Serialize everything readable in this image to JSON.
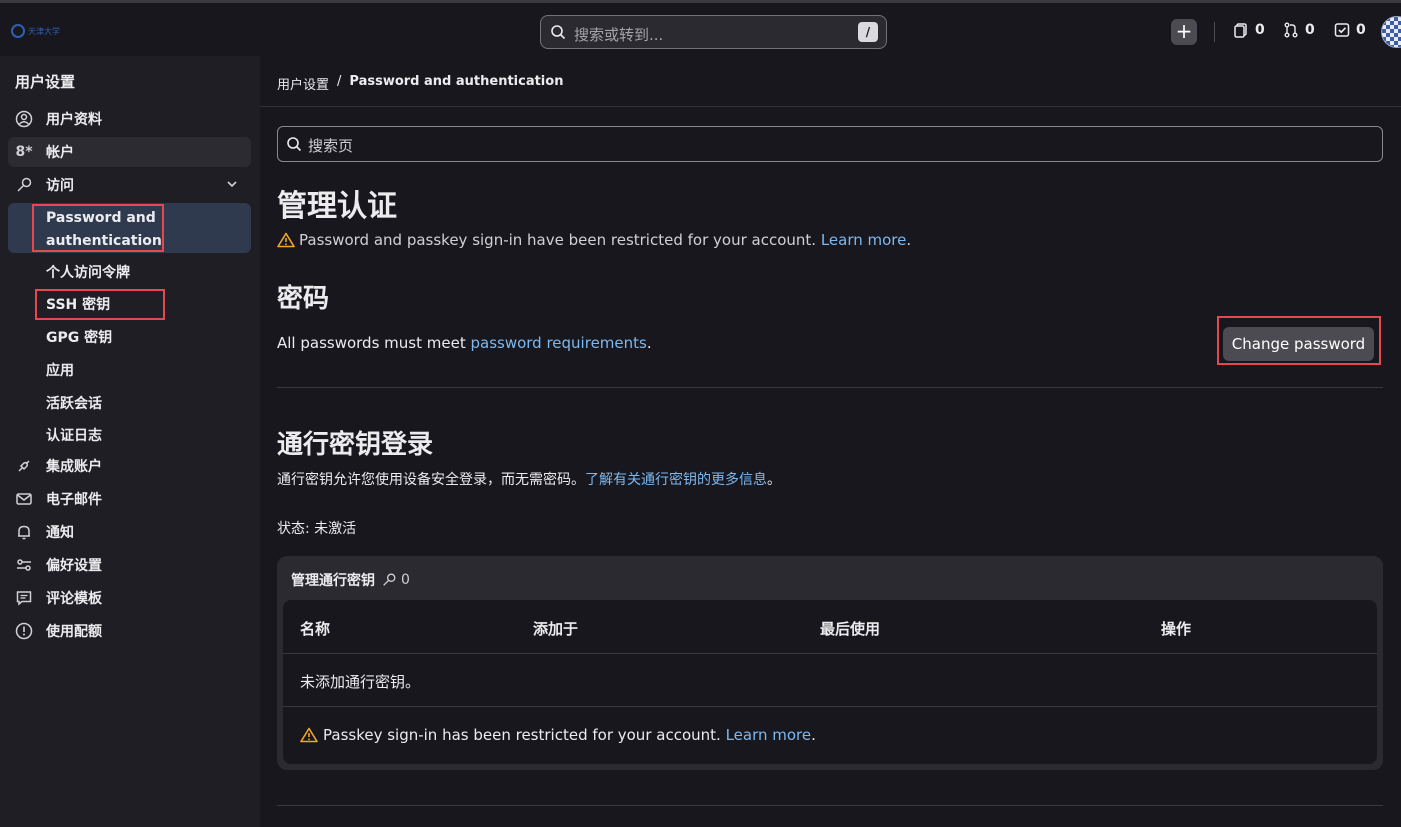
{
  "header": {
    "logo_text": "天津大学",
    "search_placeholder": "搜索或转到...",
    "search_shortcut": "/",
    "counters": [
      {
        "name": "issues",
        "value": "0"
      },
      {
        "name": "merge-requests",
        "value": "0"
      },
      {
        "name": "todos",
        "value": "0"
      }
    ]
  },
  "sidebar": {
    "title": "用户设置",
    "items": [
      {
        "label": "用户资料"
      },
      {
        "label": "帐户"
      },
      {
        "label": "访问"
      }
    ],
    "access_sub": [
      {
        "label_line1": "Password and",
        "label_line2": "authentication"
      },
      {
        "label": "个人访问令牌"
      },
      {
        "label": "SSH 密钥"
      },
      {
        "label": "GPG 密钥"
      },
      {
        "label": "应用"
      },
      {
        "label": "活跃会话"
      },
      {
        "label": "认证日志"
      }
    ],
    "items2": [
      {
        "label": "集成账户"
      },
      {
        "label": "电子邮件"
      },
      {
        "label": "通知"
      },
      {
        "label": "偏好设置"
      },
      {
        "label": "评论模板"
      },
      {
        "label": "使用配额"
      }
    ]
  },
  "breadcrumb": {
    "parent": "用户设置",
    "separator": "/",
    "current": "Password and authentication"
  },
  "page_search_placeholder": "搜索页",
  "page_title": "管理认证",
  "restriction_notice": {
    "text": "Password and passkey sign-in have been restricted for your account.",
    "link": "Learn more",
    "end": "."
  },
  "password_section": {
    "title": "密码",
    "text": "All passwords must meet",
    "link": "password requirements",
    "end": ".",
    "button": "Change password"
  },
  "passkey_section": {
    "title": "通行密钥登录",
    "text": "通行密钥允许您使用设备安全登录，而无需密码。",
    "link": "了解有关通行密钥的更多信息",
    "end": "。",
    "status": "状态: 未激活"
  },
  "passkey_card": {
    "title": "管理通行密钥",
    "count": "0",
    "columns": [
      "名称",
      "添加于",
      "最后使用",
      "操作"
    ],
    "empty": "未添加通行密钥。",
    "warning_text": "Passkey sign-in has been restricted for your account.",
    "warning_link": "Learn more",
    "warning_end": "."
  },
  "colors": {
    "accent_link": "#7db8f0",
    "highlight_box": "#e5484d",
    "warning": "#f5a623"
  }
}
